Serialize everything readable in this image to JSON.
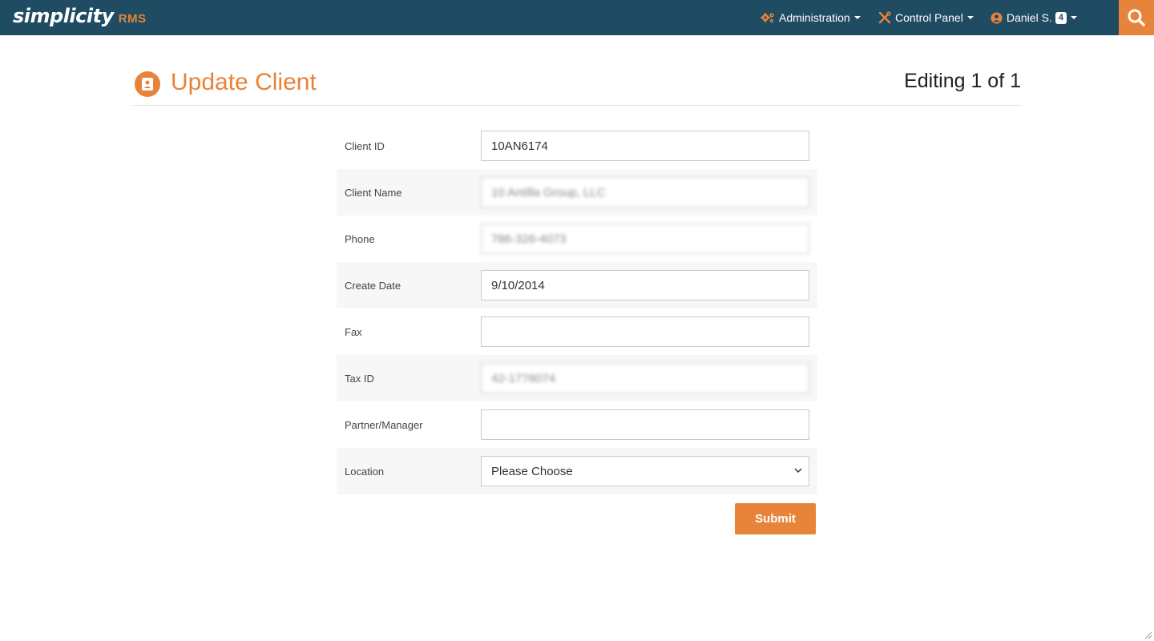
{
  "brand": {
    "name": "simplicity",
    "suffix": "RMS"
  },
  "nav": {
    "administration": "Administration",
    "control_panel": "Control Panel",
    "user": "Daniel S.",
    "notification_count": "4"
  },
  "header": {
    "title": "Update Client",
    "editing": "Editing 1 of 1"
  },
  "form": {
    "client_id": {
      "label": "Client ID",
      "value": "10AN6174"
    },
    "client_name": {
      "label": "Client Name",
      "value": "10 Antilla Group, LLC"
    },
    "phone": {
      "label": "Phone",
      "value": "786-326-4073"
    },
    "create_date": {
      "label": "Create Date",
      "value": "9/10/2014"
    },
    "fax": {
      "label": "Fax",
      "value": ""
    },
    "tax_id": {
      "label": "Tax ID",
      "value": "42-1776074"
    },
    "partner_manager": {
      "label": "Partner/Manager",
      "value": ""
    },
    "location": {
      "label": "Location",
      "selected": "Please Choose"
    },
    "submit_label": "Submit"
  },
  "colors": {
    "topbar": "#1f4b63",
    "accent": "#e8833a"
  }
}
